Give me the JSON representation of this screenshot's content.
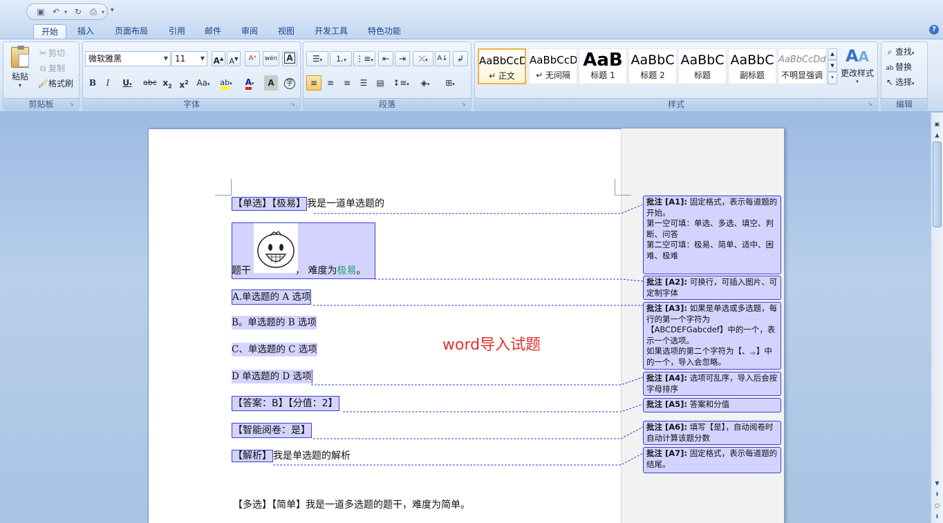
{
  "ribbon_tabs": [
    "开始",
    "插入",
    "页面布局",
    "引用",
    "邮件",
    "审阅",
    "视图",
    "开发工具",
    "特色功能"
  ],
  "clipboard": {
    "paste": "粘贴",
    "cut": "剪切",
    "copy": "复制",
    "format_painter": "格式刷",
    "group_label": "剪贴板"
  },
  "font": {
    "family": "微软雅黑",
    "size": "11",
    "group_label": "字体"
  },
  "paragraph": {
    "group_label": "段落"
  },
  "styles": {
    "items": [
      {
        "sample": "AaBbCcD",
        "name": "↵ 正文"
      },
      {
        "sample": "AaBbCcD",
        "name": "↵ 无间隔"
      },
      {
        "sample": "AaB",
        "name": "标题 1"
      },
      {
        "sample": "AaBbC",
        "name": "标题 2"
      },
      {
        "sample": "AaBbC",
        "name": "标题"
      },
      {
        "sample": "AaBbC",
        "name": "副标题"
      },
      {
        "sample": "AaBbCcDd",
        "name": "不明显强调"
      }
    ],
    "change_styles": "更改样式",
    "group_label": "样式"
  },
  "editing": {
    "find": "查找",
    "replace": "替换",
    "select": "选择",
    "group_label": "编辑"
  },
  "document": {
    "q1": {
      "tags": "【单选】【极易】",
      "title": "我是一道单选题的",
      "stem_prefix": "题干",
      "stem_mid": "， 难度为",
      "stem_diff": "极易",
      "stem_end": "。",
      "opt_a": "A.单选题的 A 选项",
      "opt_b": "B。单选题的 B 选项",
      "opt_c": "C、单选题的 C 选项",
      "opt_d": "D 单选题的 D 选项",
      "answer": "【答案：B】【分值：2】",
      "smart": "【智能阅卷：是】",
      "analysis_tag": "【解析】",
      "analysis": "我是单选题的解析"
    },
    "q2": "【多选】【简单】我是一道多选题的题干，难度为简单。"
  },
  "comments": [
    {
      "label": "批注 [A1]:",
      "text": "固定格式，表示每道题的开始。\n第一空可填：单选、多选、填空、判断、问答\n第二空可填：极易、简单、适中、困难、极难"
    },
    {
      "label": "批注 [A2]:",
      "text": "可换行，可插入图片、可定制字体"
    },
    {
      "label": "批注 [A3]:",
      "text": "如果是单选或多选题，每行的第一个字符为【ABCDEFGabcdef】中的一个，表示一个选项。\n如果选项的第二个字符为【、.。】中的一个，导入会忽略。"
    },
    {
      "label": "批注 [A4]:",
      "text": "选项可乱序，导入后会按字母排序"
    },
    {
      "label": "批注 [A5]:",
      "text": "答案和分值"
    },
    {
      "label": "批注 [A6]:",
      "text": "填写【是】，自动阅卷时自动计算该题分数"
    },
    {
      "label": "批注 [A7]:",
      "text": "固定格式，表示每道题的结尾。"
    }
  ],
  "overlay_caption": "word导入试题",
  "colors": {
    "comment_fill": "#d4d3ff",
    "comment_border": "#3b3bd3",
    "difficulty_text": "#1aa86b",
    "caption": "#e0312a"
  }
}
